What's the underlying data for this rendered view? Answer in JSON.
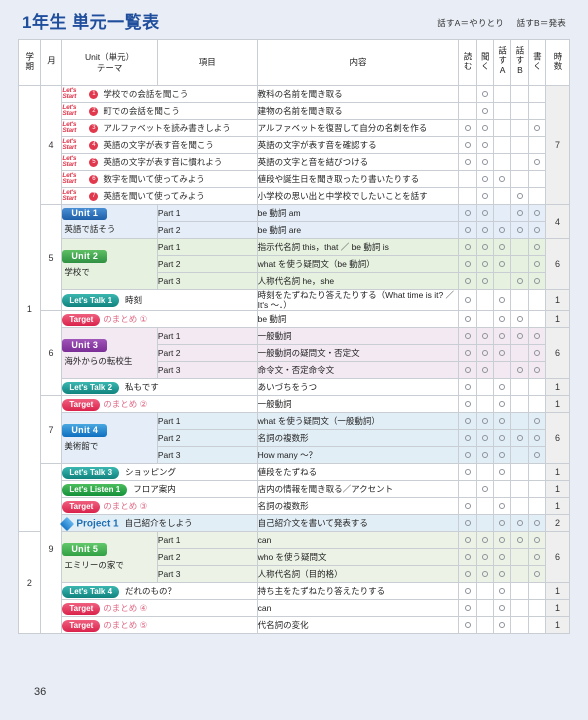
{
  "header": {
    "title": "1年生 単元一覧表",
    "legend_a": "話すA＝やりとり",
    "legend_b": "話すB＝発表"
  },
  "columns": {
    "term": "学期",
    "month": "月",
    "unit": "Unit（単元）\nテーマ",
    "unit_line1": "Unit（単元）",
    "unit_line2": "テーマ",
    "item": "項目",
    "content": "内容",
    "read": "読む",
    "listen": "聞く",
    "speakA": "話すA",
    "speakB": "話すB",
    "write": "書く",
    "hours": "時数"
  },
  "labels": {
    "lets_start": "Let's\nStart",
    "lets_start_l1": "Let's",
    "lets_start_l2": "Start"
  },
  "page_number": "36",
  "rows": [
    {
      "kind": "start",
      "num": "❶",
      "unit": "学校での会話を聞こう",
      "item": "",
      "content": "教科の名前を聞き取る",
      "marks": [
        0,
        1,
        0,
        0,
        0
      ],
      "tint": ""
    },
    {
      "kind": "start",
      "num": "❷",
      "unit": "町での会話を聞こう",
      "item": "",
      "content": "建物の名前を聞き取る",
      "marks": [
        0,
        1,
        0,
        0,
        0
      ],
      "tint": ""
    },
    {
      "kind": "start",
      "num": "❸",
      "unit": "アルファベットを読み書きしよう",
      "item": "",
      "content": "アルファベットを復習して自分の名刺を作る",
      "marks": [
        1,
        1,
        0,
        0,
        1
      ],
      "tint": ""
    },
    {
      "kind": "start",
      "num": "❹",
      "unit": "英語の文字が表す音を聞こう",
      "item": "",
      "content": "英語の文字が表す音を確認する",
      "marks": [
        1,
        1,
        0,
        0,
        0
      ],
      "tint": ""
    },
    {
      "kind": "start",
      "num": "❺",
      "unit": "英語の文字が表す音に慣れよう",
      "item": "",
      "content": "英語の文字と音を結びつける",
      "marks": [
        1,
        1,
        0,
        0,
        1
      ],
      "tint": ""
    },
    {
      "kind": "start",
      "num": "❻",
      "unit": "数字を聞いて使ってみよう",
      "item": "",
      "content": "値段や誕生日を聞き取ったり書いたりする",
      "marks": [
        0,
        1,
        1,
        0,
        0
      ],
      "tint": ""
    },
    {
      "kind": "start",
      "num": "❼",
      "unit": "英語を聞いて使ってみよう",
      "item": "",
      "content": "小学校の思い出と中学校でしたいことを話す",
      "marks": [
        0,
        1,
        0,
        1,
        0
      ],
      "tint": ""
    },
    {
      "kind": "unit",
      "badge": "Unit 1",
      "badge_style": "ub-blue",
      "theme": "英語で話そう",
      "item": "Part 1",
      "content": "be 動詞 am",
      "marks": [
        1,
        1,
        0,
        1,
        1
      ],
      "tint": "tint-blue"
    },
    {
      "kind": "unitcont",
      "item": "Part 2",
      "content": "be 動詞 are",
      "marks": [
        1,
        1,
        1,
        1,
        1
      ],
      "tint": "tint-blue"
    },
    {
      "kind": "unit",
      "badge": "Unit 2",
      "badge_style": "ub-green",
      "theme": "学校で",
      "item": "Part 1",
      "content": "指示代名詞 this，that ／ be 動詞 is",
      "marks": [
        1,
        1,
        1,
        0,
        1
      ],
      "tint": "tint-green"
    },
    {
      "kind": "unitcont",
      "item": "Part 2",
      "content": "what を使う疑問文（be 動詞）",
      "marks": [
        1,
        1,
        1,
        0,
        1
      ],
      "tint": "tint-green"
    },
    {
      "kind": "unitcont",
      "item": "Part 3",
      "content": "人称代名詞 he，she",
      "marks": [
        1,
        1,
        0,
        1,
        1
      ],
      "tint": "tint-green"
    },
    {
      "kind": "talk",
      "badge": "Let's Talk 1",
      "sub": "時刻",
      "item": "",
      "content": "時刻をたずねたり答えたりする（What time is it? ／ It's 〜．）",
      "marks": [
        1,
        0,
        1,
        0,
        0
      ],
      "tint": ""
    },
    {
      "kind": "target",
      "badge": "Target",
      "sub": "のまとめ ①",
      "item": "",
      "content": "be 動詞",
      "marks": [
        1,
        0,
        1,
        1,
        0
      ],
      "tint": ""
    },
    {
      "kind": "unit",
      "badge": "Unit 3",
      "badge_style": "ub-purple",
      "theme": "海外からの転校生",
      "item": "Part 1",
      "content": "一般動詞",
      "marks": [
        1,
        1,
        1,
        1,
        1
      ],
      "tint": "tint-purple"
    },
    {
      "kind": "unitcont",
      "item": "Part 2",
      "content": "一般動詞の疑問文・否定文",
      "marks": [
        1,
        1,
        1,
        0,
        1
      ],
      "tint": "tint-purple"
    },
    {
      "kind": "unitcont",
      "item": "Part 3",
      "content": "命令文・否定命令文",
      "marks": [
        1,
        1,
        0,
        1,
        1
      ],
      "tint": "tint-purple"
    },
    {
      "kind": "talk",
      "badge": "Let's Talk 2",
      "sub": "私もです",
      "item": "",
      "content": "あいづちをうつ",
      "marks": [
        1,
        0,
        1,
        0,
        0
      ],
      "tint": ""
    },
    {
      "kind": "target",
      "badge": "Target",
      "sub": "のまとめ ②",
      "item": "",
      "content": "一般動詞",
      "marks": [
        1,
        0,
        1,
        0,
        0
      ],
      "tint": ""
    },
    {
      "kind": "unit",
      "badge": "Unit 4",
      "badge_style": "ub-blue2",
      "theme": "美術館で",
      "item": "Part 1",
      "content": "what を使う疑問文（一般動詞）",
      "marks": [
        1,
        1,
        1,
        0,
        1
      ],
      "tint": "tint-lblue"
    },
    {
      "kind": "unitcont",
      "item": "Part 2",
      "content": "名詞の複数形",
      "marks": [
        1,
        1,
        1,
        1,
        1
      ],
      "tint": "tint-lblue"
    },
    {
      "kind": "unitcont",
      "item": "Part 3",
      "content": "How many 〜？",
      "marks": [
        1,
        1,
        1,
        0,
        1
      ],
      "tint": "tint-lblue"
    },
    {
      "kind": "talk",
      "badge": "Let's Talk 3",
      "sub": "ショッピング",
      "item": "",
      "content": "値段をたずねる",
      "marks": [
        1,
        0,
        1,
        0,
        0
      ],
      "tint": ""
    },
    {
      "kind": "listen",
      "badge": "Let's Listen 1",
      "sub": "フロア案内",
      "item": "",
      "content": "店内の情報を聞き取る／アクセント",
      "marks": [
        0,
        1,
        0,
        0,
        0
      ],
      "tint": ""
    },
    {
      "kind": "target",
      "badge": "Target",
      "sub": "のまとめ ③",
      "item": "",
      "content": "名詞の複数形",
      "marks": [
        1,
        0,
        1,
        0,
        0
      ],
      "tint": ""
    },
    {
      "kind": "project",
      "badge": "Project 1",
      "sub": "自己紹介をしよう",
      "item": "",
      "content": "自己紹介文を書いて発表する",
      "marks": [
        1,
        0,
        1,
        1,
        1
      ],
      "tint": "tint-lblue"
    },
    {
      "kind": "unit",
      "badge": "Unit 5",
      "badge_style": "ub-green2",
      "theme": "エミリーの家で",
      "item": "Part 1",
      "content": "can",
      "marks": [
        1,
        1,
        1,
        1,
        1
      ],
      "tint": "tint-lgreen"
    },
    {
      "kind": "unitcont",
      "item": "Part 2",
      "content": "who を使う疑問文",
      "marks": [
        1,
        1,
        1,
        0,
        1
      ],
      "tint": "tint-lgreen"
    },
    {
      "kind": "unitcont",
      "item": "Part 3",
      "content": "人称代名詞（目的格）",
      "marks": [
        1,
        1,
        1,
        0,
        1
      ],
      "tint": "tint-lgreen"
    },
    {
      "kind": "talk",
      "badge": "Let's Talk 4",
      "sub": "だれのもの？",
      "item": "",
      "content": "持ち主をたずねたり答えたりする",
      "marks": [
        1,
        0,
        1,
        0,
        0
      ],
      "tint": ""
    },
    {
      "kind": "target",
      "badge": "Target",
      "sub": "のまとめ ④",
      "item": "",
      "content": "can",
      "marks": [
        1,
        0,
        1,
        0,
        0
      ],
      "tint": ""
    },
    {
      "kind": "target",
      "badge": "Target",
      "sub": "のまとめ ⑤",
      "item": "",
      "content": "代名詞の変化",
      "marks": [
        1,
        0,
        1,
        0,
        0
      ],
      "tint": ""
    }
  ],
  "terms": [
    {
      "label": "1",
      "span": 26
    },
    {
      "label": "2",
      "span": 6
    }
  ],
  "months": [
    {
      "label": "4",
      "span": 7
    },
    {
      "label": "5",
      "span": 6
    },
    {
      "label": "6",
      "span": 5
    },
    {
      "label": "7",
      "span": 4
    },
    {
      "label": "9",
      "span": 10
    }
  ],
  "hours": [
    {
      "label": "7",
      "span": 7
    },
    {
      "label": "4",
      "span": 2
    },
    {
      "label": "6",
      "span": 3
    },
    {
      "label": "1",
      "span": 1
    },
    {
      "label": "1",
      "span": 1
    },
    {
      "label": "6",
      "span": 3
    },
    {
      "label": "1",
      "span": 1
    },
    {
      "label": "1",
      "span": 1
    },
    {
      "label": "6",
      "span": 3
    },
    {
      "label": "1",
      "span": 1
    },
    {
      "label": "1",
      "span": 1
    },
    {
      "label": "1",
      "span": 1
    },
    {
      "label": "2",
      "span": 1
    },
    {
      "label": "6",
      "span": 3
    },
    {
      "label": "1",
      "span": 1
    },
    {
      "label": "1",
      "span": 1
    },
    {
      "label": "1",
      "span": 1
    }
  ]
}
